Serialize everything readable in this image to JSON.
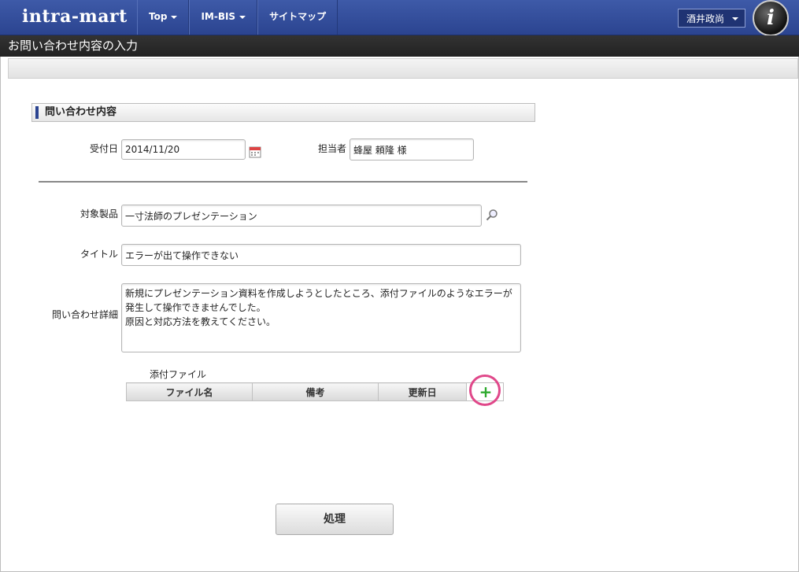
{
  "header": {
    "logo": "intra-mart",
    "nav": [
      {
        "label": "Top"
      },
      {
        "label": "IM-BIS"
      },
      {
        "label": "サイトマップ"
      }
    ],
    "user_name": "酒井政尚",
    "avatar_glyph": "i"
  },
  "page_title": "お問い合わせ内容の入力",
  "section": {
    "title": "問い合わせ内容"
  },
  "form": {
    "reception_date_label": "受付日",
    "reception_date_value": "2014/11/20",
    "assignee_label": "担当者",
    "assignee_value": "蜂屋 頼隆 様",
    "product_label": "対象製品",
    "product_value": "一寸法師のプレゼンテーション",
    "title_label": "タイトル",
    "title_value": "エラーが出て操作できない",
    "detail_label": "問い合わせ詳細",
    "detail_value": "新規にプレゼンテーション資料を作成しようとしたところ、添付ファイルのようなエラーが発生して操作できませんでした。\n原因と対応方法を教えてください。"
  },
  "attachments": {
    "label": "添付ファイル",
    "columns": [
      "ファイル名",
      "備考",
      "更新日"
    ],
    "add_icon": "plus-icon"
  },
  "submit_label": "処理",
  "colors": {
    "header_blue": "#2b4490",
    "highlight": "#e0488a",
    "add_green": "#2eaa2e"
  }
}
